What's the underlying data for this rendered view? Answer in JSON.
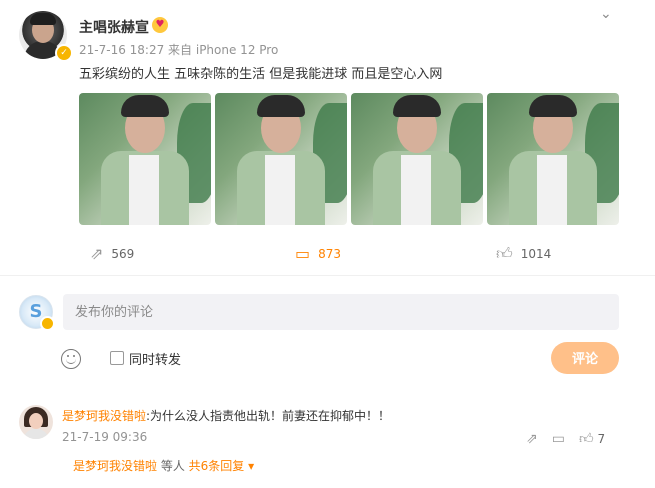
{
  "post": {
    "username": "主唱张赫宣",
    "meta": "21-7-16 18:27  来自 iPhone 12 Pro",
    "text": "五彩缤纷的人生 五味杂陈的生活 但是我能进球 而且是空心入网",
    "more_icon": "chevron-down-icon",
    "photos": [
      {
        "name": "photo-1",
        "icon": "photo"
      },
      {
        "name": "photo-2",
        "icon": "photo"
      },
      {
        "name": "photo-3",
        "icon": "photo"
      },
      {
        "name": "photo-4",
        "icon": "photo"
      }
    ],
    "actions": {
      "share_count": "569",
      "comment_count": "873",
      "like_count": "1014"
    }
  },
  "composer": {
    "placeholder": "发布你的评论",
    "repost_label": "同时转发",
    "submit_label": "评论"
  },
  "comment": {
    "username": "是梦珂我没错啦",
    "text": ":为什么没人指责他出轨！前妻还在抑郁中！！",
    "time": "21-7-19 09:36",
    "like_count": "7",
    "reply_summary_user": "是梦珂我没错啦",
    "reply_summary_mid": " 等人 ",
    "reply_summary_more": "共6条回复 ▾"
  },
  "colors": {
    "accent": "#ff8200",
    "submit_bg": "#ffc089",
    "muted": "#939393"
  }
}
